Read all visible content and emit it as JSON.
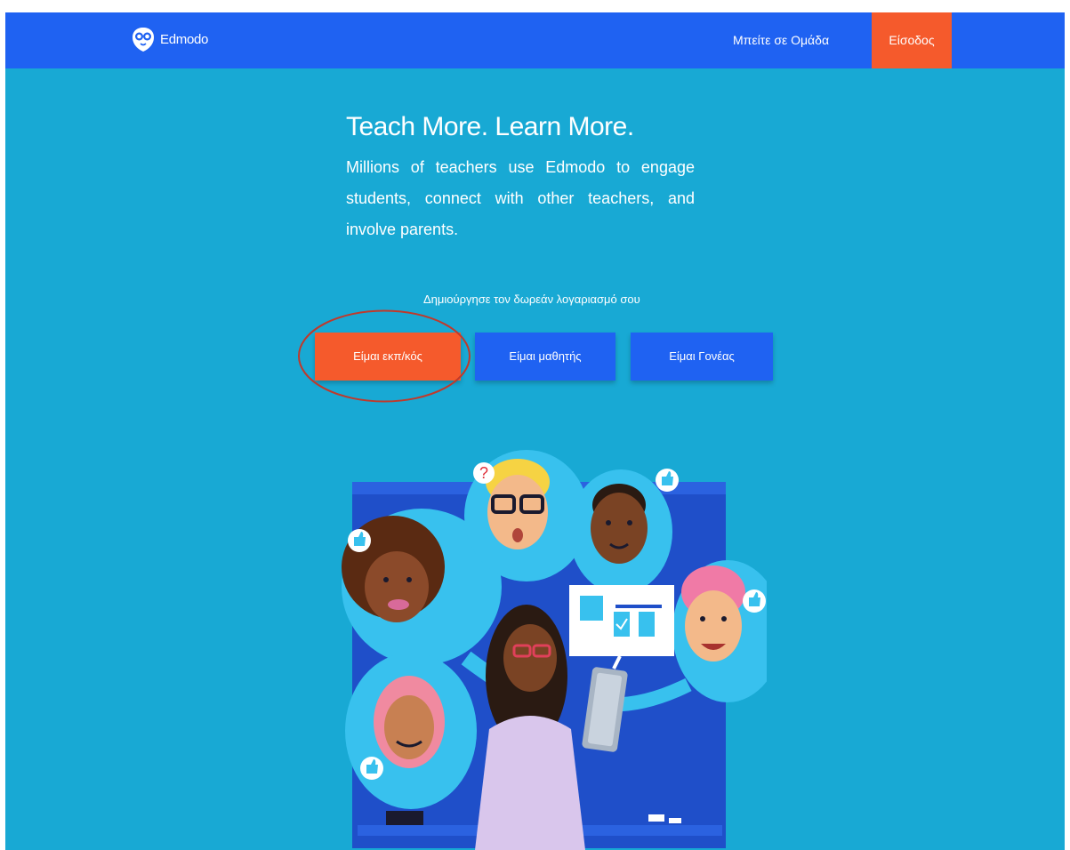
{
  "nav": {
    "brand": "Edmodo",
    "join_group": "Μπείτε σε Ομάδα",
    "login": "Είσοδος"
  },
  "hero": {
    "title": "Teach More. Learn More.",
    "text": "Millions of teachers use Edmodo to engage students, connect with other teachers, and involve parents."
  },
  "signup": {
    "label": "Δημιούργησε τον δωρεάν λογαριασμό σου",
    "buttons": {
      "teacher": "Είμαι εκπ/κός",
      "student": "Είμαι μαθητής",
      "parent": "Είμαι Γονέας"
    }
  },
  "colors": {
    "background": "#18a9d4",
    "nav": "#1f62f2",
    "accent": "#f55a2c",
    "annotation_circle": "#c0392b"
  },
  "icons": {
    "brand_logo": "owl-logo-icon",
    "question": "question-mark-icon",
    "thumbs_up": "thumbs-up-icon",
    "check": "check-icon"
  }
}
